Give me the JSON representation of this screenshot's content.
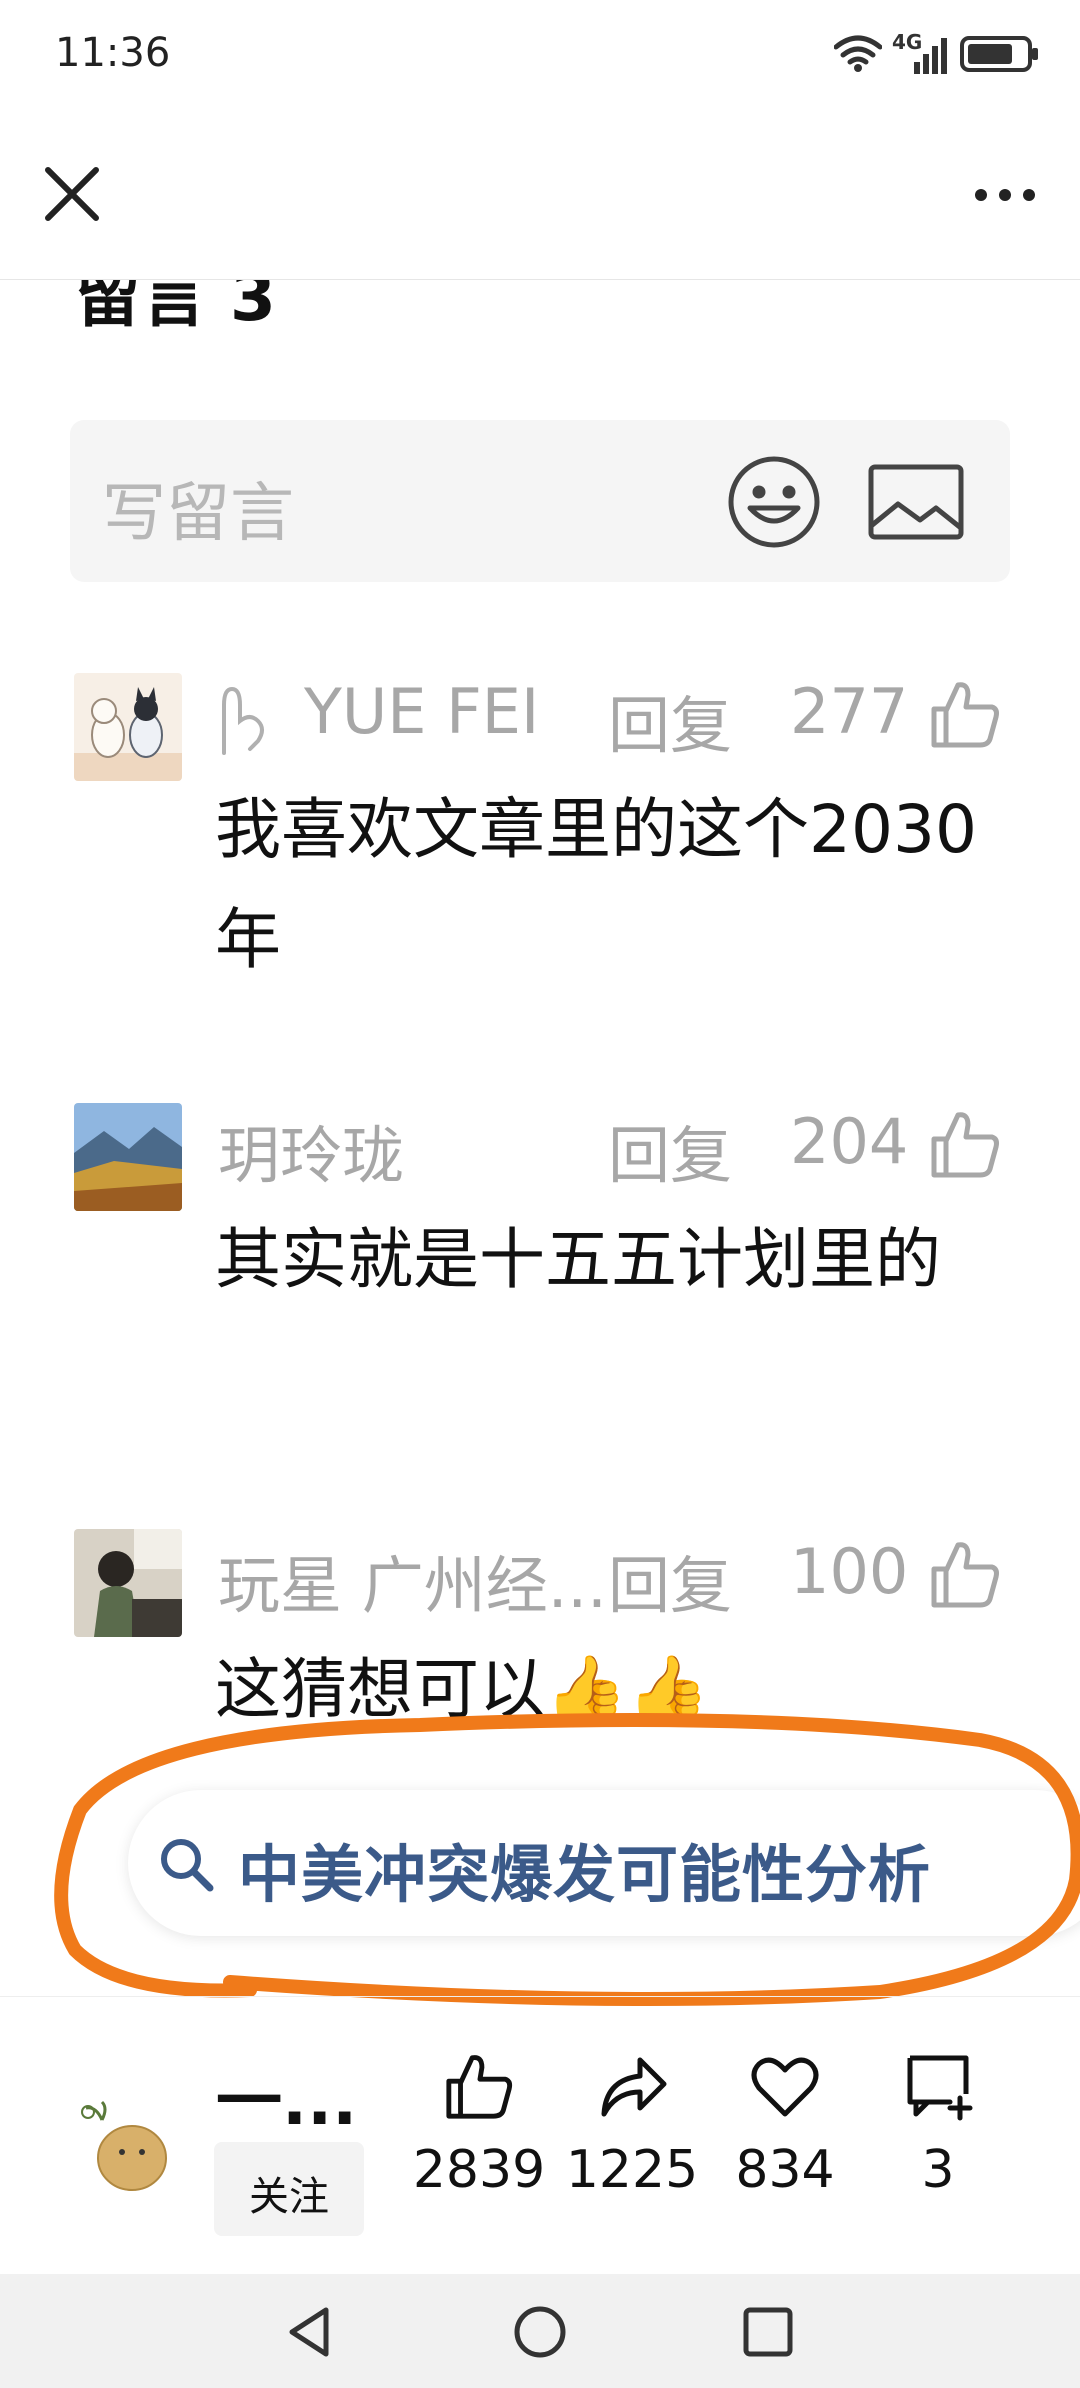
{
  "status_bar": {
    "time": "11:36",
    "network": "4G"
  },
  "header": {
    "comments_title": "留言 3"
  },
  "comment_input": {
    "placeholder": "写留言"
  },
  "comments": [
    {
      "name": "YUE FEI",
      "reply": "回复",
      "likes": "277",
      "text": "我喜欢文章里的这个2030年"
    },
    {
      "name": "玥玲珑",
      "reply": "回复",
      "likes": "204",
      "text": "其实就是十五五计划里的"
    },
    {
      "name": "玩星  广州经...",
      "reply": "回复",
      "likes": "100",
      "text": "这猜想可以👍👍"
    }
  ],
  "search_suggestion": {
    "text": "中美冲突爆发可能性分析"
  },
  "bottom_bar": {
    "author_name": "一...",
    "follow_label": "关注",
    "like_count": "2839",
    "share_count": "1225",
    "favorite_count": "834",
    "comment_count": "3"
  },
  "colors": {
    "highlight": "#f07a1a",
    "suggest_text": "#3b5a89",
    "muted": "#a7a7a7"
  }
}
